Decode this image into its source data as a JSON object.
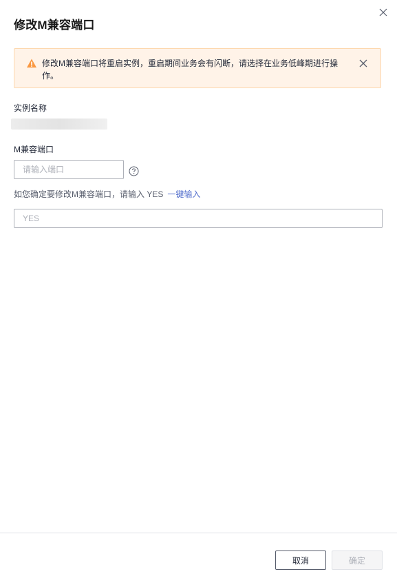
{
  "dialog": {
    "title": "修改M兼容端口"
  },
  "alert": {
    "message": "修改M兼容端口将重启实例，重启期间业务会有闪断，请选择在业务低峰期进行操作。",
    "icon": "warning-icon",
    "accent_color": "#f66f6a"
  },
  "instance": {
    "label": "实例名称",
    "value": ""
  },
  "port": {
    "label": "M兼容端口",
    "value": "",
    "placeholder": "请输入端口"
  },
  "confirm": {
    "hint": "如您确定要修改M兼容端口，请输入 YES",
    "one_click_label": "一键输入",
    "value": "",
    "placeholder": "YES"
  },
  "footer": {
    "cancel_label": "取消",
    "ok_label": "确定"
  }
}
